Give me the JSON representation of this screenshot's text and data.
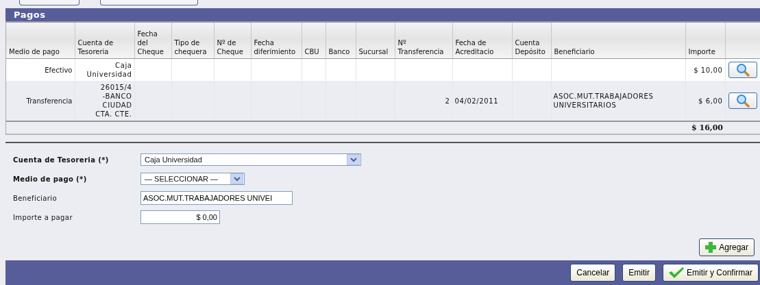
{
  "section": {
    "title": "Pagos"
  },
  "table": {
    "columns": [
      "Medio de pago",
      "Cuenta de\nTesoreria",
      "Fecha\ndel\nCheque",
      "Tipo de\nchequera",
      "Nº de\nCheque",
      "Fecha\ndiferimiento",
      "CBU",
      "Banco",
      "Sucursal",
      "Nº\nTransferencia",
      "Fecha de\nAcreditacio",
      "Cuenta\nDepósito",
      "Beneficiario",
      "Importe"
    ],
    "rows": [
      {
        "cells": [
          "Efectivo",
          "Caja\nUniversidad",
          null,
          null,
          null,
          null,
          null,
          null,
          null,
          null,
          null,
          null,
          null,
          "$ 10,00"
        ]
      },
      {
        "cells": [
          "Transferencia",
          "26015/4\n-BANCO\nCIUDAD\nCTA. CTE.",
          null,
          null,
          null,
          null,
          null,
          null,
          null,
          "2",
          "04/02/2011",
          null,
          "ASOC.MUT.TRABAJADORES\nUNIVERSITARIOS",
          "$ 6,00"
        ]
      }
    ],
    "total": "$ 16,00"
  },
  "form": {
    "fields": [
      {
        "label": "Cuenta de Tesoreria (*)",
        "required": true,
        "kind": "select",
        "value": "Caja Universidad"
      },
      {
        "label": "Medio de pago (*)",
        "required": true,
        "kind": "select",
        "value": "— SELECCIONAR —"
      },
      {
        "label": "Beneficiario",
        "required": false,
        "kind": "text",
        "value": "ASOC.MUT.TRABAJADORES UNIVEI"
      },
      {
        "label": "Importe a pagar",
        "required": false,
        "kind": "amount",
        "value": "$ 0,00"
      }
    ],
    "add_button": {
      "label": "Agregar",
      "kind": "add"
    }
  },
  "footer": {
    "buttons": [
      {
        "label": "Cancelar",
        "kind": "plain"
      },
      {
        "label": "Emitir",
        "kind": "plain"
      },
      {
        "label": "Emitir y Confirmar",
        "kind": "confirm"
      }
    ]
  }
}
